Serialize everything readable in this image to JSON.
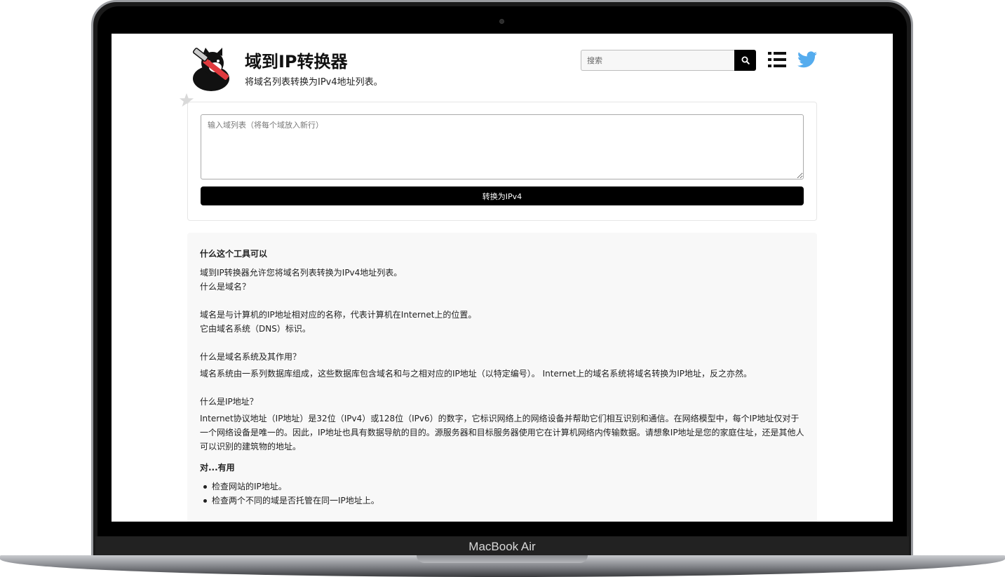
{
  "device": {
    "model_label": "MacBook Air"
  },
  "header": {
    "title": "域到IP转换器",
    "subtitle": "将域名列表转换为IPv4地址列表。",
    "search_placeholder": "搜索",
    "icons": {
      "search": "search-icon",
      "menu": "list-menu-icon",
      "social": "twitter-icon",
      "favorite": "star-icon"
    },
    "colors": {
      "twitter": "#55acee",
      "search_button": "#000000"
    }
  },
  "converter": {
    "textarea_placeholder": "输入域列表（将每个域放入新行）",
    "textarea_value": "",
    "button_label": "转换为IPv4"
  },
  "info": {
    "heading_what": "什么这个工具可以",
    "p1": "域到IP转换器允许您将域名列表转换为IPv4地址列表。",
    "q_domain": "什么是域名？",
    "a_domain_1": "域名是与计算机的IP地址相对应的名称，代表计算机在Internet上的位置。",
    "a_domain_2": "它由域名系统（DNS）标识。",
    "q_dns": "什么是域名系统及其作用？",
    "a_dns": "域名系统由一系列数据库组成，这些数据库包含域名和与之相对应的IP地址（以特定编号）。 Internet上的域名系统将域名转换为IP地址，反之亦然。",
    "q_ip": "什么是IP地址？",
    "a_ip": "Internet协议地址（IP地址）是32位（IPv4）或128位（IPv6）的数字，它标识网络上的网络设备并帮助它们相互识别和通信。在网络模型中，每个IP地址仅对于一个网络设备是唯一的。因此，IP地址也具有数据导航的目的。源服务器和目标服务器使用它在计算机网络内传输数据。请想象IP地址是您的家庭住址，还是其他人可以识别的建筑物的地址。",
    "heading_useful": "对...有用",
    "uses": [
      "检查网站的IP地址。",
      "检查两个不同的域是否托管在同一IP地址上。"
    ]
  }
}
